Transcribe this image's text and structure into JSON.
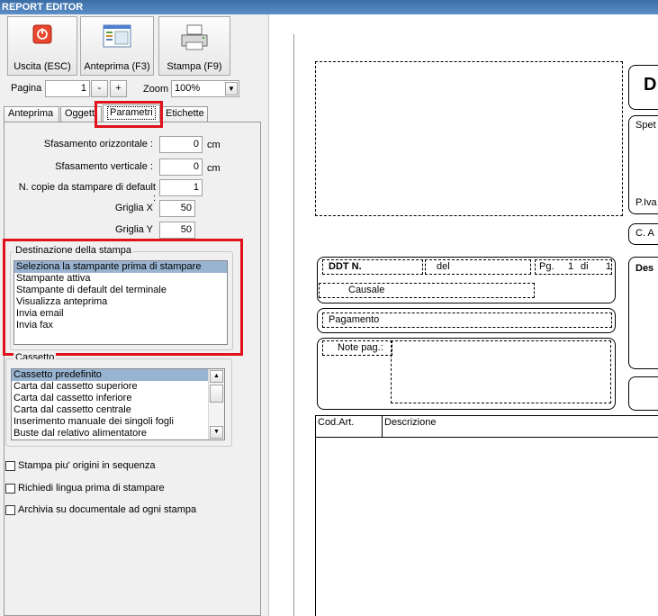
{
  "window": {
    "title": "REPORT EDITOR"
  },
  "toolbar": {
    "exit_label": "Uscita (ESC)",
    "preview_label": "Anteprima (F3)",
    "print_label": "Stampa (F9)"
  },
  "paging": {
    "page_label": "Pagina",
    "page_value": "1",
    "minus": "-",
    "plus": "+",
    "zoom_label": "Zoom",
    "zoom_value": "100%"
  },
  "tabs": [
    "Anteprima",
    "Oggetti",
    "Parametri",
    "Etichette"
  ],
  "params": {
    "h_offset_label": "Sfasamento orizzontale :",
    "h_offset_value": "0",
    "h_unit": "cm",
    "v_offset_label": "Sfasamento verticale :",
    "v_offset_value": "0",
    "v_unit": "cm",
    "copies_label": "N. copie da stampare di default :",
    "copies_value": "1",
    "grid_x_label": "Griglia X",
    "grid_x_value": "50",
    "grid_y_label": "Griglia Y",
    "grid_y_value": "50"
  },
  "destination": {
    "title": "Destinazione della stampa",
    "items": [
      "Seleziona la stampante prima di stampare",
      "Stampante attiva",
      "Stampante di default del terminale",
      "Visualizza anteprima",
      "Invia email",
      "Invia fax"
    ],
    "selected": "Seleziona la stampante prima di stampare"
  },
  "drawer": {
    "title": "Cassetto",
    "items": [
      "Cassetto predefinito",
      "Carta dal cassetto superiore",
      "Carta dal cassetto inferiore",
      "Carta dal cassetto centrale",
      "Inserimento manuale dei singoli fogli",
      "Buste dal relativo alimentatore"
    ],
    "selected": "Cassetto predefinito"
  },
  "checkboxes": [
    "Stampa piu' origini in sequenza",
    "Richiedi lingua prima di stampare",
    "Archivia su documentale ad ogni stampa"
  ],
  "report": {
    "header_letter": "D",
    "sender": "Spet",
    "piva": "P.Iva",
    "ca": "C. A",
    "ddt_label": "DDT N.",
    "del_label": "del",
    "pg_label": "Pg.",
    "pg_value": "1",
    "di_label": "di",
    "di_value": "1",
    "causale_label": "Causale",
    "dest_label": "Des",
    "pagamento_label": "Pagamento",
    "note_label": "Note pag.:",
    "col_code": "Cod.Art.",
    "col_desc": "Descrizione"
  }
}
